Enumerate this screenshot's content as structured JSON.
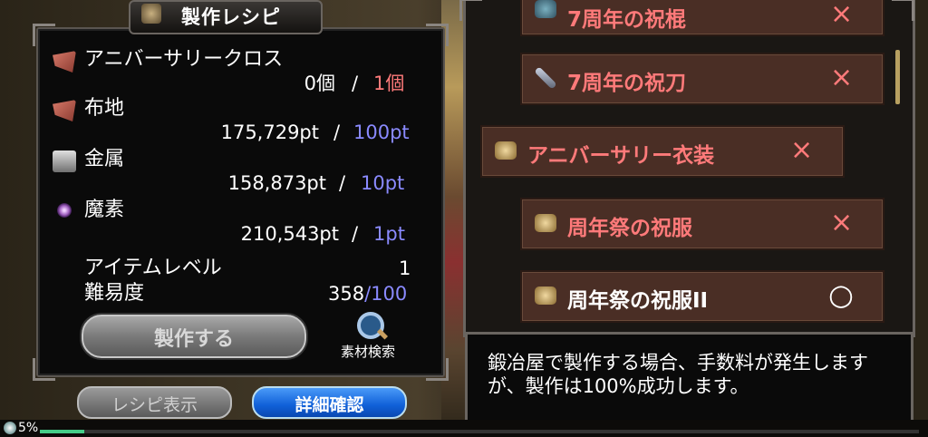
{
  "title": "製作レシピ",
  "materials": [
    {
      "name": "アニバーサリークロス",
      "have": "0個",
      "need": "1個",
      "icon": "cloth-icon"
    },
    {
      "name": "布地",
      "have": "175,729pt",
      "need": "100pt",
      "icon": "cloth-icon"
    },
    {
      "name": "金属",
      "have": "158,873pt",
      "need": "10pt",
      "icon": "metal-icon"
    },
    {
      "name": "魔素",
      "have": "210,543pt",
      "need": "1pt",
      "icon": "magic-orb-icon"
    }
  ],
  "separator": "/",
  "item_level_label": "アイテムレベル",
  "item_level_value": "1",
  "difficulty_label": "難易度",
  "difficulty_value": "358",
  "difficulty_max": "/100",
  "craft_button": "製作する",
  "search_label": "素材検索",
  "recipe_button": "レシピ表示",
  "detail_button": "詳細確認",
  "progress_text": "5%",
  "progress_value": 0.05,
  "recipes": [
    {
      "name": "7周年の祝棍",
      "status": "×",
      "icon": "club-icon"
    },
    {
      "name": "7周年の祝刀",
      "status": "×",
      "icon": "sword-icon"
    },
    {
      "name": "アニバーサリー衣装",
      "status": "×",
      "icon": "scroll-icon"
    },
    {
      "name": "周年祭の祝服",
      "status": "×",
      "icon": "scroll-icon"
    },
    {
      "name": "周年祭の祝服II",
      "status": "○",
      "icon": "scroll-icon"
    }
  ],
  "description": "鍛冶屋で製作する場合、手数料が発生しますが、製作は100%成功します。",
  "colors": {
    "insufficient": "#ff7a7a",
    "sufficient": "#8a8aff"
  }
}
